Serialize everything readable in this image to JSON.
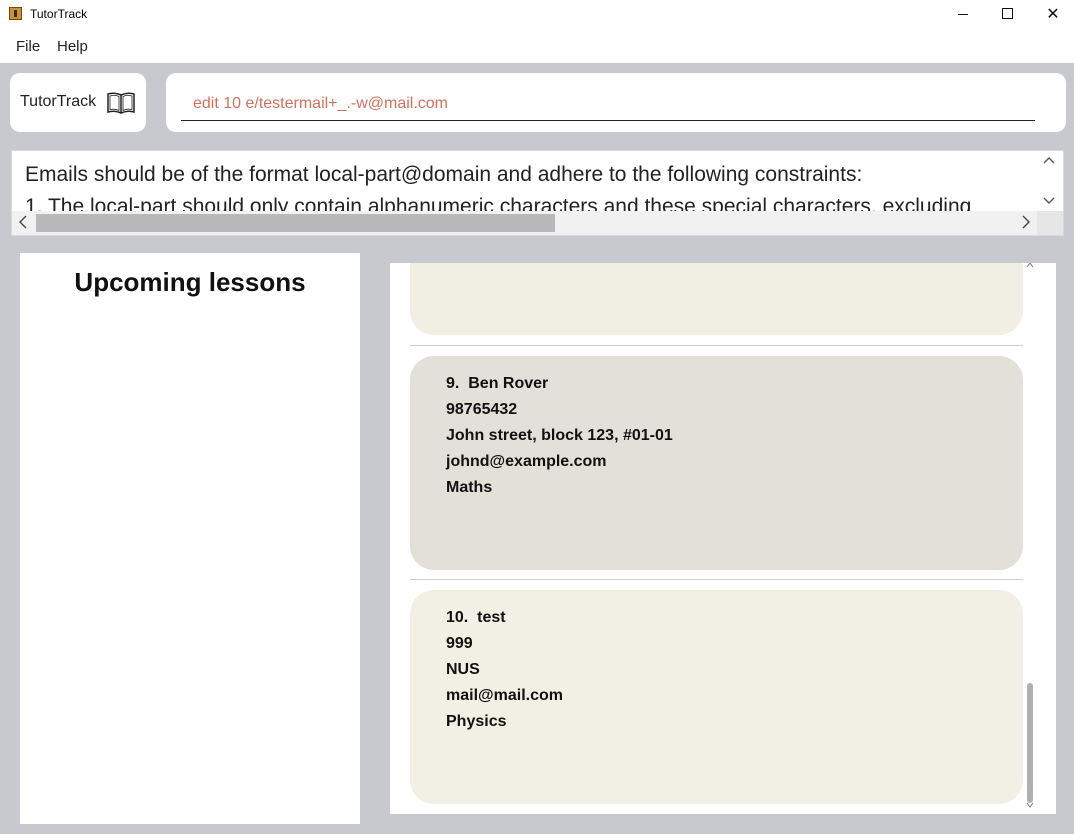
{
  "window": {
    "title": "TutorTrack",
    "minimize_icon": "minimize-icon",
    "maximize_icon": "maximize-icon",
    "close_symbol": "✕"
  },
  "menu": {
    "items": [
      "File",
      "Help"
    ]
  },
  "header": {
    "logo_text": "TutorTrack",
    "logo_icon": "book-icon"
  },
  "command": {
    "value": "edit 10 e/testermail+_.-w@mail.com",
    "text_color": "#d3715b"
  },
  "result": {
    "line1": "Emails should be of the format local-part@domain and adhere to the following constraints:",
    "line2": "1. The local-part should only contain alphanumeric characters and these special characters, excluding"
  },
  "lessons": {
    "title": "Upcoming lessons"
  },
  "persons": [
    {
      "index_name": "9.  Ben Rover",
      "phone": "98765432",
      "address": "John street, block 123, #01-01",
      "email": "johnd@example.com",
      "subject": "Maths"
    },
    {
      "index_name": "10.  test",
      "phone": "999",
      "address": "NUS",
      "email": "mail@mail.com",
      "subject": "Physics"
    }
  ],
  "colors": {
    "background": "#c8c9ce",
    "card_selected": "#e3e0d9",
    "card": "#f2efe4"
  }
}
